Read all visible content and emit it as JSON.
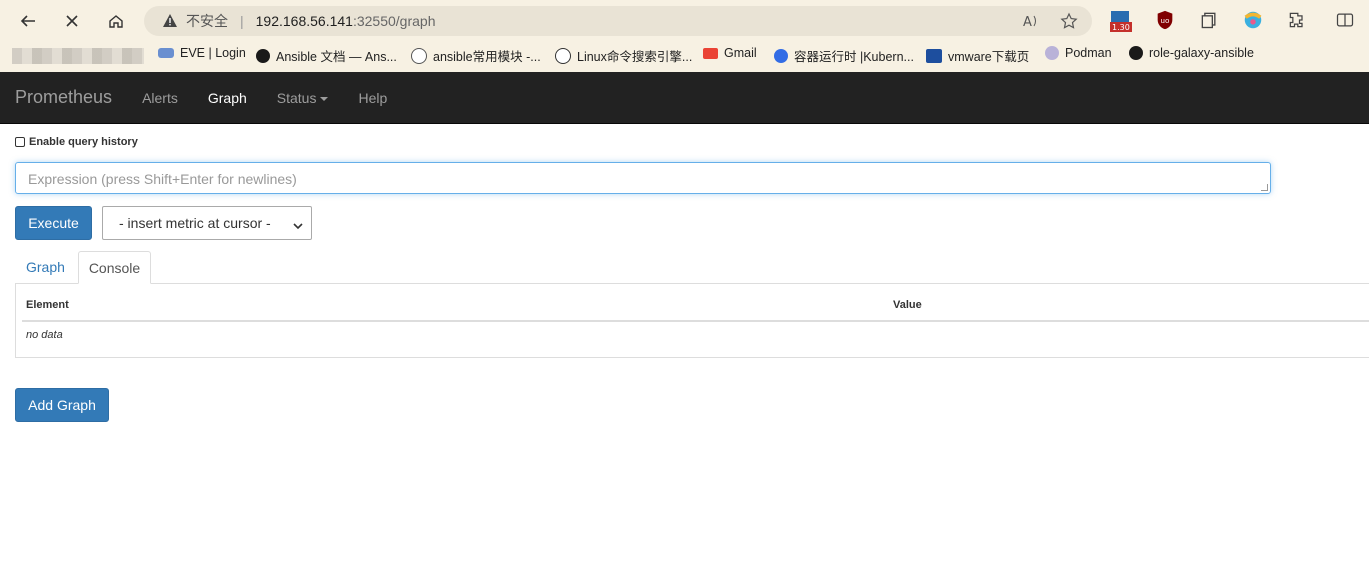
{
  "browser": {
    "address": {
      "insecure_label": "不安全",
      "separator": "|",
      "host": "192.168.56.141",
      "rest": ":32550/graph"
    },
    "extensions": {
      "badge": "1.30"
    },
    "bookmarks": [
      {
        "label": "EVE | Login"
      },
      {
        "label": "Ansible 文档 — Ans..."
      },
      {
        "label": "ansible常用模块 -..."
      },
      {
        "label": "Linux命令搜索引擎..."
      },
      {
        "label": "Gmail"
      },
      {
        "label": "容器运行时 |Kubern..."
      },
      {
        "label": "vmware下载页"
      },
      {
        "label": "Podman"
      },
      {
        "label": "role-galaxy-ansible"
      }
    ]
  },
  "prometheus": {
    "brand": "Prometheus",
    "nav": {
      "alerts": "Alerts",
      "graph": "Graph",
      "status": "Status",
      "help": "Help"
    },
    "history_label": "Enable query history",
    "expression_placeholder": "Expression (press Shift+Enter for newlines)",
    "execute_label": "Execute",
    "metric_select": "- insert metric at cursor -",
    "tabs": {
      "graph": "Graph",
      "console": "Console"
    },
    "table": {
      "col_element": "Element",
      "col_value": "Value",
      "empty": "no data"
    },
    "add_graph_label": "Add Graph"
  }
}
